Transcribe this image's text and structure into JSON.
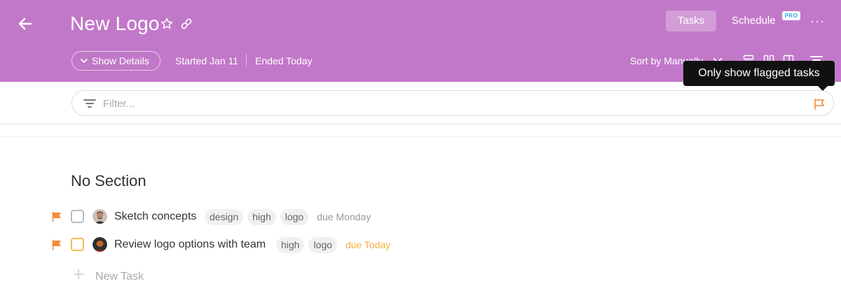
{
  "header": {
    "title": "New Logo",
    "tabs": {
      "tasks": "Tasks",
      "schedule": "Schedule",
      "pro_badge": "PRO"
    },
    "more": "···",
    "show_details": "Show Details",
    "started": "Started Jan 11",
    "ended": "Ended Today",
    "sort": "Sort by Manually",
    "bg_color": "#c278c8"
  },
  "icons": {
    "back": "back-arrow-icon",
    "star": "star-icon",
    "link": "link-icon",
    "filter": "filter-icon",
    "flag": "flag-icon",
    "plus": "plus-icon"
  },
  "tooltip": {
    "text": "Only show flagged tasks"
  },
  "filter": {
    "placeholder": "Filter...",
    "value": ""
  },
  "section": {
    "title": "No Section",
    "tasks": [
      {
        "name": "Sketch concepts",
        "flagged": true,
        "tags": [
          "design",
          "high",
          "logo"
        ],
        "due": "due Monday"
      },
      {
        "name": "Review logo options with team",
        "flagged": true,
        "tags": [
          "high",
          "logo"
        ],
        "due": "due Today"
      }
    ],
    "new_task": "New Task"
  },
  "colors": {
    "flag": "#f28c38",
    "due_today": "#f4b23e",
    "accent": "#c278c8"
  }
}
